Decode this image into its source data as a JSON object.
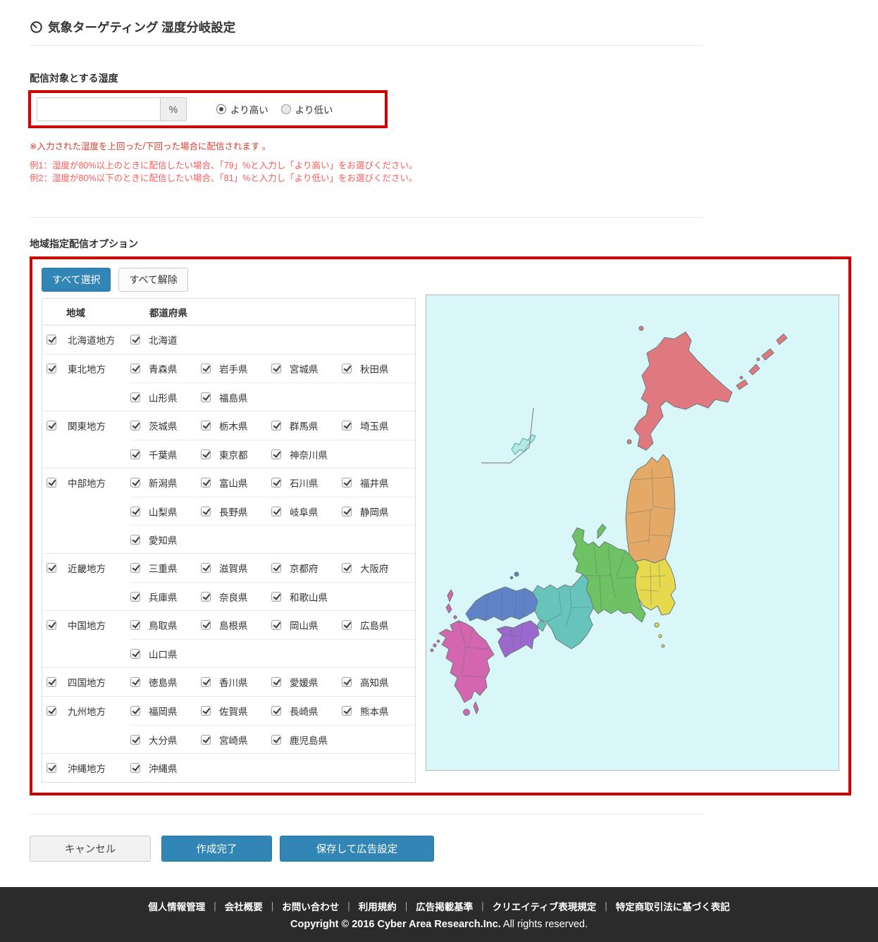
{
  "header": {
    "title": "気象ターゲティング 湿度分岐設定"
  },
  "humidity": {
    "label": "配信対象とする湿度",
    "value": "",
    "unit": "%",
    "options": {
      "higher": "より高い",
      "lower": "より低い"
    },
    "selected_option": "higher",
    "note": "※入力された湿度を上回った/下回った場合に配信されます 。",
    "examples": [
      "例1：湿度が80%以上のときに配信したい場合、「79」%と入力し「より高い」をお選びください。",
      "例2：湿度が80%以下のときに配信したい場合、「81」%と入力し「より低い」をお選びください。"
    ]
  },
  "regions": {
    "label": "地域指定配信オプション",
    "select_all_label": "すべて選択",
    "clear_all_label": "すべて解除",
    "columns": {
      "region": "地域",
      "prefecture": "都道府県"
    },
    "groups": [
      {
        "name": "北海道地方",
        "checked": true,
        "prefectures": [
          "北海道"
        ]
      },
      {
        "name": "東北地方",
        "checked": true,
        "prefectures": [
          "青森県",
          "岩手県",
          "宮城県",
          "秋田県",
          "山形県",
          "福島県"
        ]
      },
      {
        "name": "関東地方",
        "checked": true,
        "prefectures": [
          "茨城県",
          "栃木県",
          "群馬県",
          "埼玉県",
          "千葉県",
          "東京都",
          "神奈川県"
        ]
      },
      {
        "name": "中部地方",
        "checked": true,
        "prefectures": [
          "新潟県",
          "富山県",
          "石川県",
          "福井県",
          "山梨県",
          "長野県",
          "岐阜県",
          "静岡県",
          "愛知県"
        ]
      },
      {
        "name": "近畿地方",
        "checked": true,
        "prefectures": [
          "三重県",
          "滋賀県",
          "京都府",
          "大阪府",
          "兵庫県",
          "奈良県",
          "和歌山県"
        ]
      },
      {
        "name": "中国地方",
        "checked": true,
        "prefectures": [
          "鳥取県",
          "島根県",
          "岡山県",
          "広島県",
          "山口県"
        ]
      },
      {
        "name": "四国地方",
        "checked": true,
        "prefectures": [
          "徳島県",
          "香川県",
          "愛媛県",
          "高知県"
        ]
      },
      {
        "name": "九州地方",
        "checked": true,
        "prefectures": [
          "福岡県",
          "佐賀県",
          "長崎県",
          "熊本県",
          "大分県",
          "宮崎県",
          "鹿児島県"
        ]
      },
      {
        "name": "沖縄地方",
        "checked": true,
        "prefectures": [
          "沖縄県"
        ]
      }
    ],
    "map_colors": {
      "sea": "#d9f7f8",
      "hokkaido": "#e0797f",
      "tohoku": "#e4a967",
      "kanto": "#e7d94e",
      "chubu": "#6fc263",
      "kinki": "#66c4bc",
      "chugoku": "#5f82c8",
      "shikoku": "#9b68cd",
      "kyushu": "#d366ae",
      "okinawa": "#b5e8e2"
    }
  },
  "actions": {
    "cancel": "キャンセル",
    "complete": "作成完了",
    "save_ad": "保存して広告設定"
  },
  "footer": {
    "links": [
      "個人情報管理",
      "会社概要",
      "お問い合わせ",
      "利用規約",
      "広告掲載基準",
      "クリエイティブ表現規定",
      "特定商取引法に基づく表記"
    ],
    "copyright_strong": "Copyright © 2016 Cyber Area Research.Inc.",
    "copyright_rest": "All rights reserved."
  }
}
